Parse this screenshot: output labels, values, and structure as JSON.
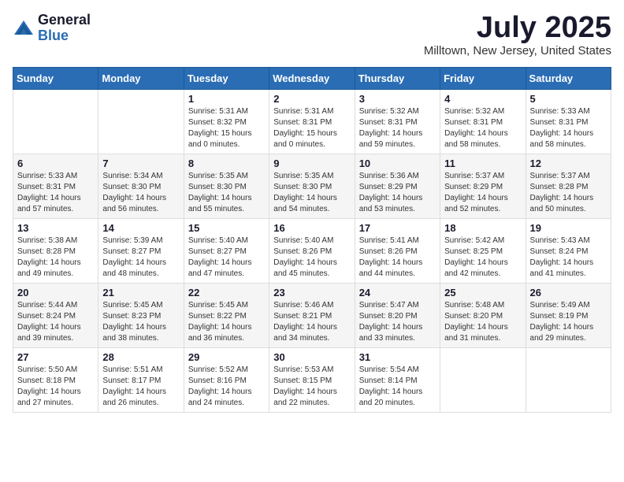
{
  "header": {
    "logo_general": "General",
    "logo_blue": "Blue",
    "month_title": "July 2025",
    "location": "Milltown, New Jersey, United States"
  },
  "weekdays": [
    "Sunday",
    "Monday",
    "Tuesday",
    "Wednesday",
    "Thursday",
    "Friday",
    "Saturday"
  ],
  "weeks": [
    [
      {
        "day": "",
        "info": ""
      },
      {
        "day": "",
        "info": ""
      },
      {
        "day": "1",
        "info": "Sunrise: 5:31 AM\nSunset: 8:32 PM\nDaylight: 15 hours and 0 minutes."
      },
      {
        "day": "2",
        "info": "Sunrise: 5:31 AM\nSunset: 8:31 PM\nDaylight: 15 hours and 0 minutes."
      },
      {
        "day": "3",
        "info": "Sunrise: 5:32 AM\nSunset: 8:31 PM\nDaylight: 14 hours and 59 minutes."
      },
      {
        "day": "4",
        "info": "Sunrise: 5:32 AM\nSunset: 8:31 PM\nDaylight: 14 hours and 58 minutes."
      },
      {
        "day": "5",
        "info": "Sunrise: 5:33 AM\nSunset: 8:31 PM\nDaylight: 14 hours and 58 minutes."
      }
    ],
    [
      {
        "day": "6",
        "info": "Sunrise: 5:33 AM\nSunset: 8:31 PM\nDaylight: 14 hours and 57 minutes."
      },
      {
        "day": "7",
        "info": "Sunrise: 5:34 AM\nSunset: 8:30 PM\nDaylight: 14 hours and 56 minutes."
      },
      {
        "day": "8",
        "info": "Sunrise: 5:35 AM\nSunset: 8:30 PM\nDaylight: 14 hours and 55 minutes."
      },
      {
        "day": "9",
        "info": "Sunrise: 5:35 AM\nSunset: 8:30 PM\nDaylight: 14 hours and 54 minutes."
      },
      {
        "day": "10",
        "info": "Sunrise: 5:36 AM\nSunset: 8:29 PM\nDaylight: 14 hours and 53 minutes."
      },
      {
        "day": "11",
        "info": "Sunrise: 5:37 AM\nSunset: 8:29 PM\nDaylight: 14 hours and 52 minutes."
      },
      {
        "day": "12",
        "info": "Sunrise: 5:37 AM\nSunset: 8:28 PM\nDaylight: 14 hours and 50 minutes."
      }
    ],
    [
      {
        "day": "13",
        "info": "Sunrise: 5:38 AM\nSunset: 8:28 PM\nDaylight: 14 hours and 49 minutes."
      },
      {
        "day": "14",
        "info": "Sunrise: 5:39 AM\nSunset: 8:27 PM\nDaylight: 14 hours and 48 minutes."
      },
      {
        "day": "15",
        "info": "Sunrise: 5:40 AM\nSunset: 8:27 PM\nDaylight: 14 hours and 47 minutes."
      },
      {
        "day": "16",
        "info": "Sunrise: 5:40 AM\nSunset: 8:26 PM\nDaylight: 14 hours and 45 minutes."
      },
      {
        "day": "17",
        "info": "Sunrise: 5:41 AM\nSunset: 8:26 PM\nDaylight: 14 hours and 44 minutes."
      },
      {
        "day": "18",
        "info": "Sunrise: 5:42 AM\nSunset: 8:25 PM\nDaylight: 14 hours and 42 minutes."
      },
      {
        "day": "19",
        "info": "Sunrise: 5:43 AM\nSunset: 8:24 PM\nDaylight: 14 hours and 41 minutes."
      }
    ],
    [
      {
        "day": "20",
        "info": "Sunrise: 5:44 AM\nSunset: 8:24 PM\nDaylight: 14 hours and 39 minutes."
      },
      {
        "day": "21",
        "info": "Sunrise: 5:45 AM\nSunset: 8:23 PM\nDaylight: 14 hours and 38 minutes."
      },
      {
        "day": "22",
        "info": "Sunrise: 5:45 AM\nSunset: 8:22 PM\nDaylight: 14 hours and 36 minutes."
      },
      {
        "day": "23",
        "info": "Sunrise: 5:46 AM\nSunset: 8:21 PM\nDaylight: 14 hours and 34 minutes."
      },
      {
        "day": "24",
        "info": "Sunrise: 5:47 AM\nSunset: 8:20 PM\nDaylight: 14 hours and 33 minutes."
      },
      {
        "day": "25",
        "info": "Sunrise: 5:48 AM\nSunset: 8:20 PM\nDaylight: 14 hours and 31 minutes."
      },
      {
        "day": "26",
        "info": "Sunrise: 5:49 AM\nSunset: 8:19 PM\nDaylight: 14 hours and 29 minutes."
      }
    ],
    [
      {
        "day": "27",
        "info": "Sunrise: 5:50 AM\nSunset: 8:18 PM\nDaylight: 14 hours and 27 minutes."
      },
      {
        "day": "28",
        "info": "Sunrise: 5:51 AM\nSunset: 8:17 PM\nDaylight: 14 hours and 26 minutes."
      },
      {
        "day": "29",
        "info": "Sunrise: 5:52 AM\nSunset: 8:16 PM\nDaylight: 14 hours and 24 minutes."
      },
      {
        "day": "30",
        "info": "Sunrise: 5:53 AM\nSunset: 8:15 PM\nDaylight: 14 hours and 22 minutes."
      },
      {
        "day": "31",
        "info": "Sunrise: 5:54 AM\nSunset: 8:14 PM\nDaylight: 14 hours and 20 minutes."
      },
      {
        "day": "",
        "info": ""
      },
      {
        "day": "",
        "info": ""
      }
    ]
  ]
}
